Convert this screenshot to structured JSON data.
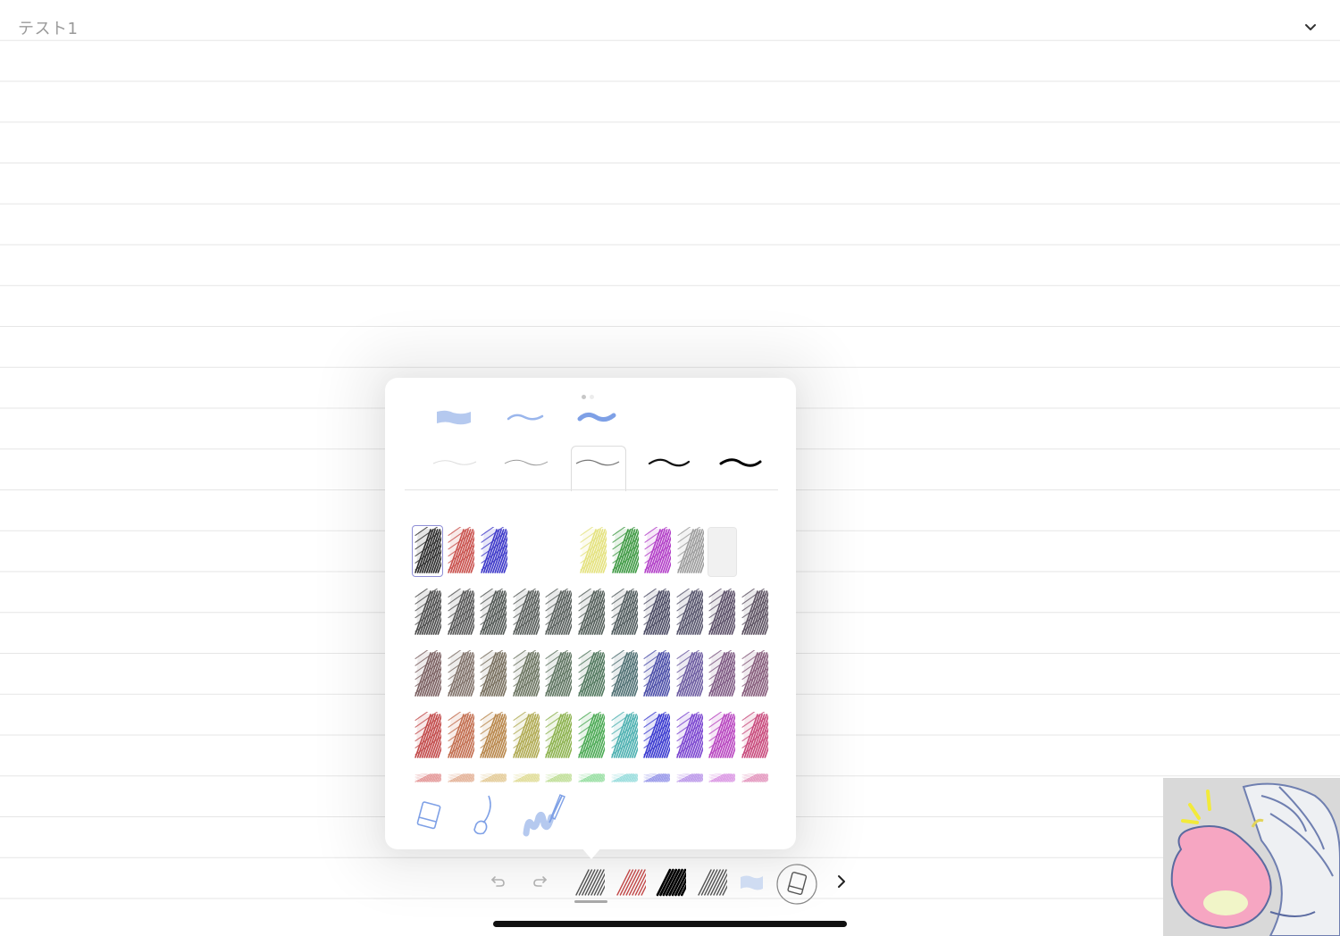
{
  "document": {
    "title": "テスト1"
  },
  "popover": {
    "page_dots": 2,
    "highlighter_strokes": [
      "wide-flat",
      "thin",
      "bold"
    ],
    "pen_widths": [
      "extra-fine",
      "fine",
      "medium",
      "bold",
      "extra-bold"
    ],
    "selected_width_index": 2,
    "accent_color": "#7ea0e6",
    "favorite_colors": [
      {
        "name": "black",
        "color": "#2b2b2b"
      },
      {
        "name": "red",
        "color": "#c9504c"
      },
      {
        "name": "blue",
        "color": "#3d38c9"
      },
      {
        "name": "empty",
        "color": ""
      },
      {
        "name": "empty",
        "color": ""
      },
      {
        "name": "yellow",
        "color": "#e4e27e"
      },
      {
        "name": "green",
        "color": "#3f9a44"
      },
      {
        "name": "magenta",
        "color": "#b23ec8"
      },
      {
        "name": "gray",
        "color": "#9c9c9c"
      },
      {
        "name": "white",
        "color": "#eeeeee"
      }
    ],
    "selected_favorite_index": 0,
    "palette_rows": [
      [
        "#4a4a4a",
        "#545454",
        "#505653",
        "#565b58",
        "#565d5a",
        "#525d58",
        "#4f5a5c",
        "#4a4a63",
        "#55536b",
        "#594d66",
        "#5b5060"
      ],
      [
        "#7a5f60",
        "#7f7068",
        "#776e5d",
        "#6b7460",
        "#5e7460",
        "#50775d",
        "#4e6f72",
        "#4a4da8",
        "#6b5aa0",
        "#7d5882",
        "#865c7b"
      ],
      [
        "#c24a4a",
        "#c26d4e",
        "#b8864a",
        "#b0aa52",
        "#8cb24e",
        "#4caa55",
        "#4cb0b0",
        "#3a3ad0",
        "#7a44d0",
        "#b845c0",
        "#c84a7c"
      ],
      [
        "#e08a8a",
        "#e0a88a",
        "#e0c48a",
        "#dcd88a",
        "#b8da8a",
        "#8ada96",
        "#8ad8d8",
        "#8a8ae6",
        "#b28ae6",
        "#d68ae0",
        "#e08ab6"
      ]
    ],
    "tools": [
      "eraser",
      "lasso",
      "brush"
    ]
  },
  "toolbar": {
    "items": [
      "undo",
      "redo",
      "pen-gray",
      "pen-red",
      "pen-black",
      "pen-gray-2",
      "highlighter",
      "eraser",
      "more"
    ],
    "selected": "pen-gray"
  }
}
